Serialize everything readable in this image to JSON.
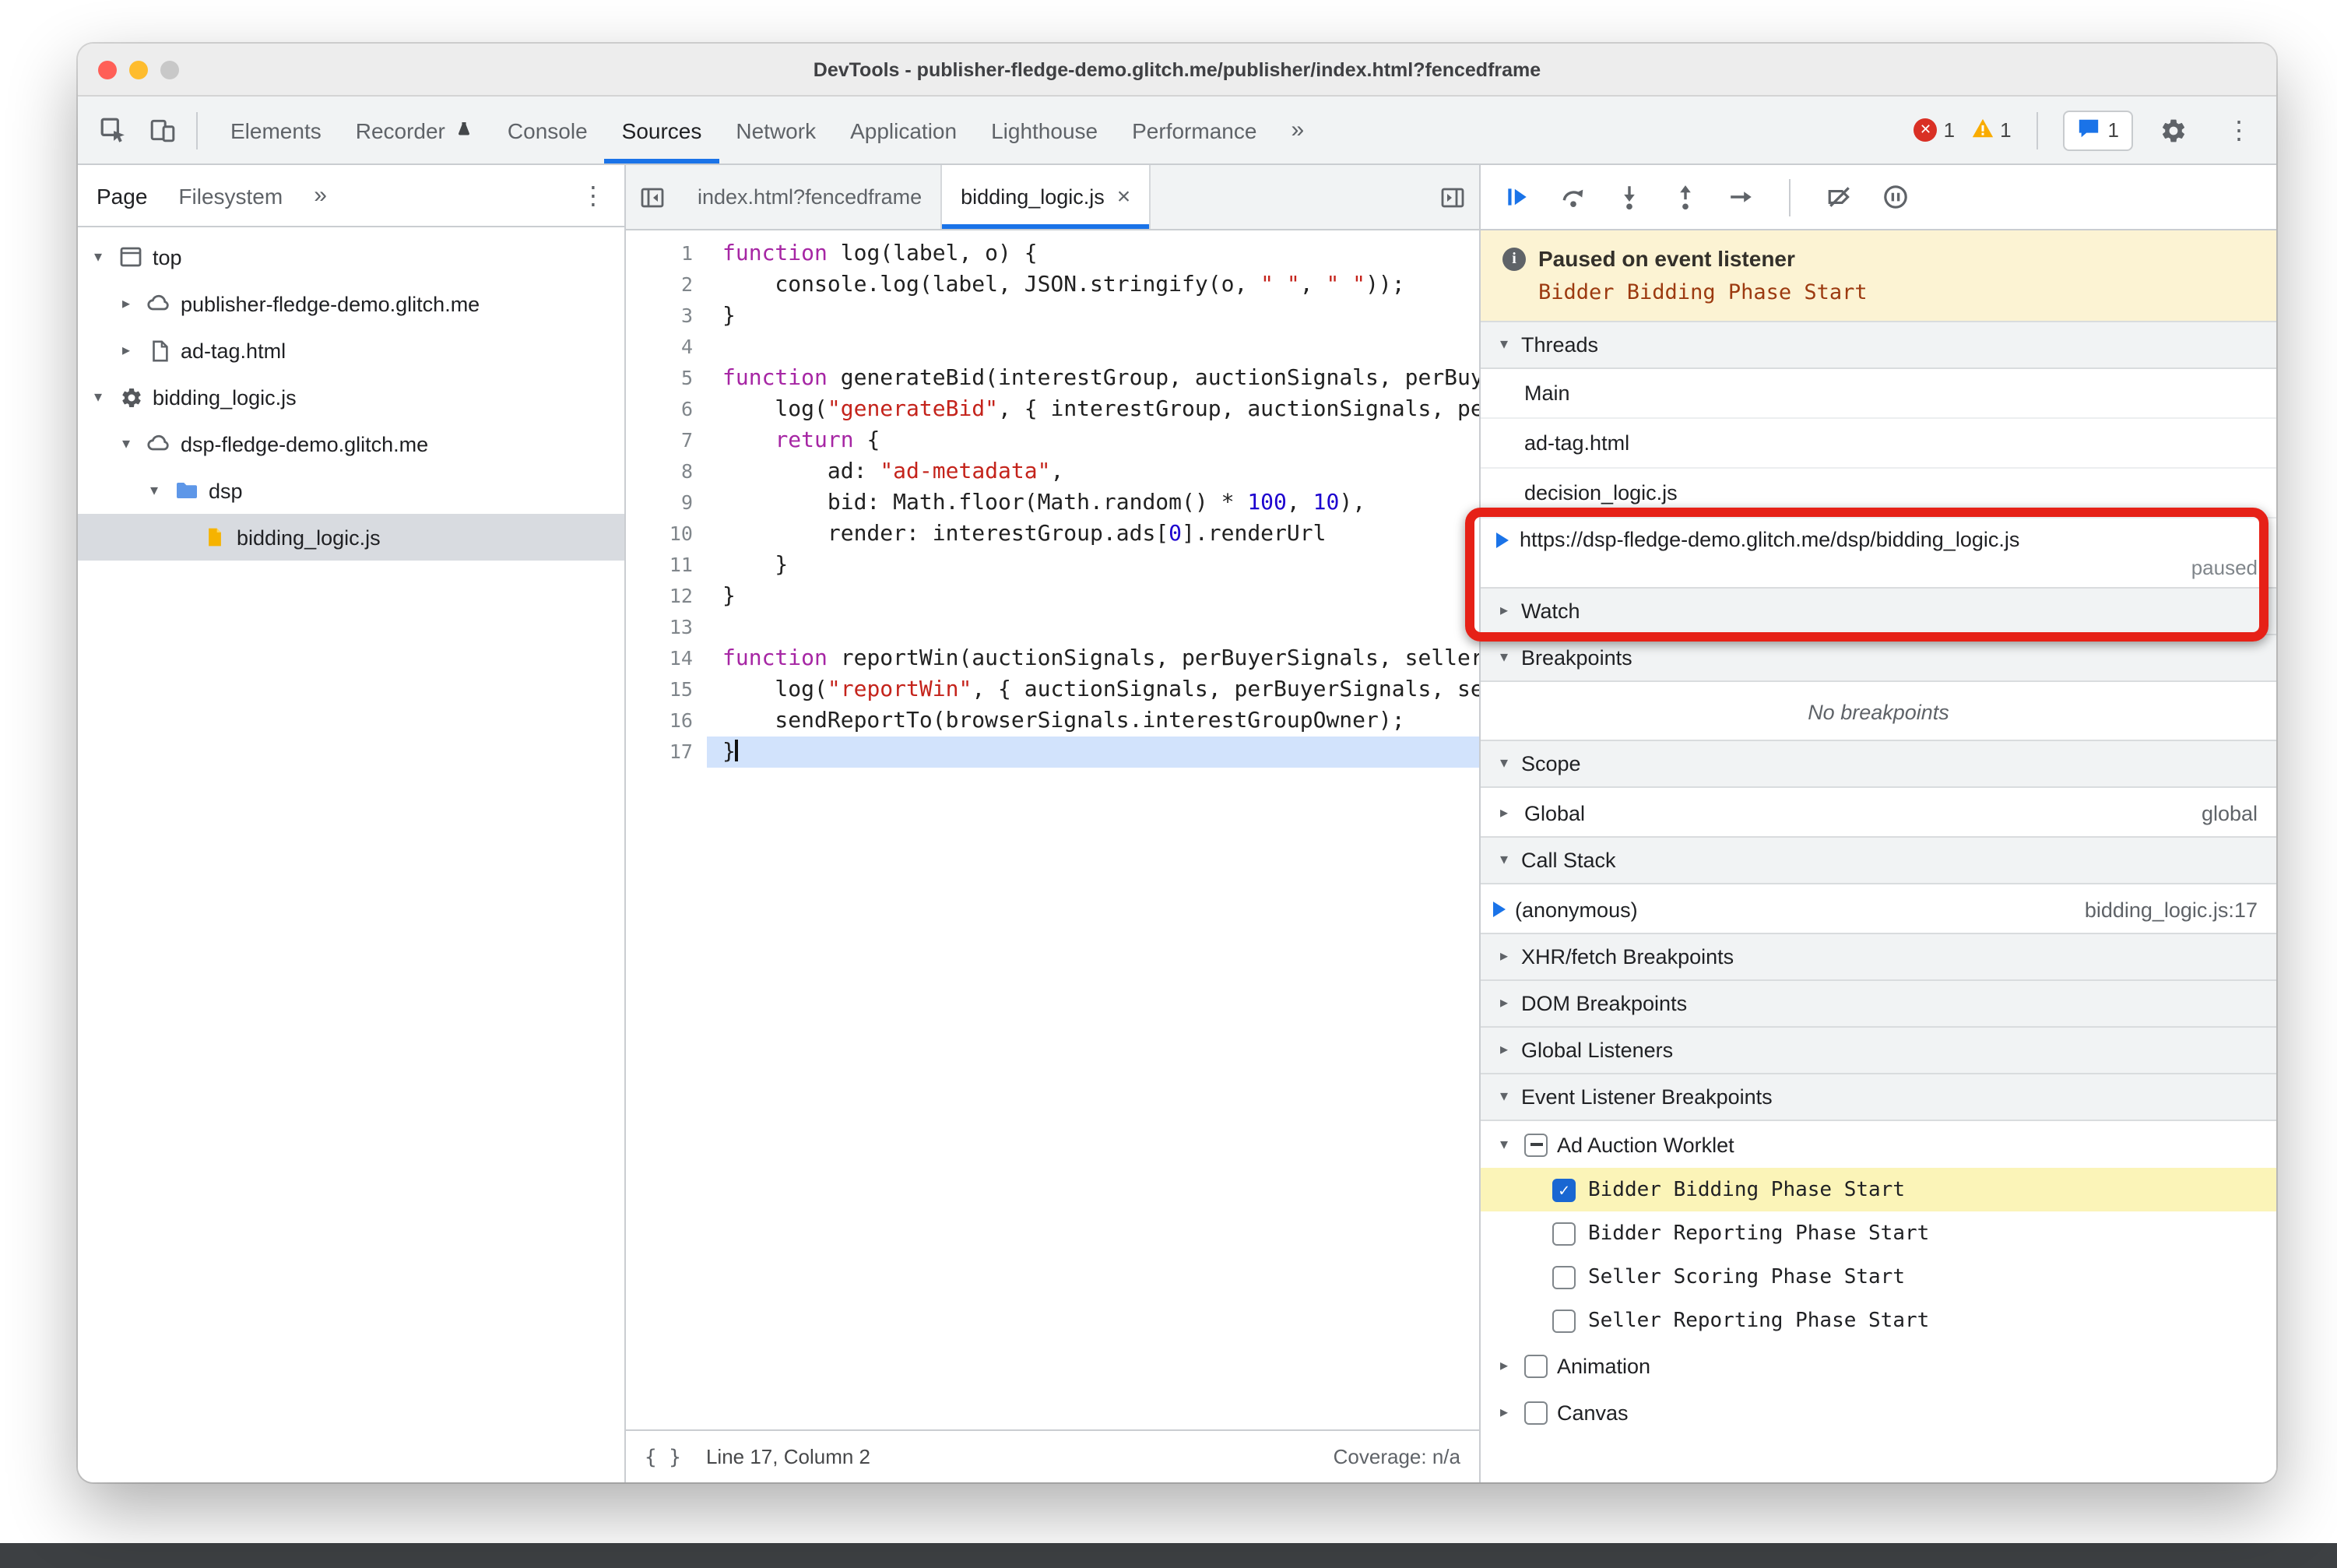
{
  "window": {
    "title": "DevTools - publisher-fledge-demo.glitch.me/publisher/index.html?fencedframe"
  },
  "toolbar": {
    "tabs": [
      "Elements",
      "Recorder",
      "Console",
      "Sources",
      "Network",
      "Application",
      "Lighthouse",
      "Performance"
    ],
    "active_tab": "Sources",
    "error_count": "1",
    "warning_count": "1",
    "issues_count": "1"
  },
  "sidebar": {
    "tabs": [
      "Page",
      "Filesystem"
    ],
    "active_tab": "Page",
    "tree": [
      {
        "label": "top",
        "icon": "frame",
        "depth": 0,
        "disclosure": "open"
      },
      {
        "label": "publisher-fledge-demo.glitch.me",
        "icon": "cloud",
        "depth": 1,
        "disclosure": "closed"
      },
      {
        "label": "ad-tag.html",
        "icon": "document",
        "depth": 1,
        "disclosure": "closed"
      },
      {
        "label": "bidding_logic.js",
        "icon": "gear",
        "depth": 0,
        "disclosure": "open"
      },
      {
        "label": "dsp-fledge-demo.glitch.me",
        "icon": "cloud",
        "depth": 1,
        "disclosure": "open"
      },
      {
        "label": "dsp",
        "icon": "folder",
        "depth": 2,
        "disclosure": "open"
      },
      {
        "label": "bidding_logic.js",
        "icon": "filejs",
        "depth": 3,
        "selected": true
      }
    ]
  },
  "editor": {
    "tabs": [
      {
        "label": "index.html?fencedframe",
        "active": false,
        "closable": false
      },
      {
        "label": "bidding_logic.js",
        "active": true,
        "closable": true
      }
    ],
    "active_line": 17,
    "lines": [
      [
        [
          "k",
          "function"
        ],
        [
          "d",
          " log(label, o) {"
        ]
      ],
      [
        [
          "d",
          "    console.log(label, JSON.stringify(o, "
        ],
        [
          "s",
          "\" \""
        ],
        [
          "d",
          ", "
        ],
        [
          "s",
          "\" \""
        ],
        [
          "d",
          "));"
        ]
      ],
      [
        [
          "d",
          "}"
        ]
      ],
      [],
      [
        [
          "k",
          "function"
        ],
        [
          "d",
          " generateBid(interestGroup, auctionSignals, perBuyerSignals, trustedBiddingSignals, browserSignals) {"
        ]
      ],
      [
        [
          "d",
          "    log("
        ],
        [
          "s",
          "\"generateBid\""
        ],
        [
          "d",
          ", { interestGroup, auctionSignals, perBuyerSignals, trustedBiddingSignals, browserSignals });"
        ]
      ],
      [
        [
          "d",
          "    "
        ],
        [
          "k",
          "return"
        ],
        [
          "d",
          " {"
        ]
      ],
      [
        [
          "d",
          "        ad: "
        ],
        [
          "s",
          "\"ad-metadata\""
        ],
        [
          "d",
          ","
        ]
      ],
      [
        [
          "d",
          "        bid: Math.floor(Math.random() * "
        ],
        [
          "n",
          "100"
        ],
        [
          "d",
          ", "
        ],
        [
          "n",
          "10"
        ],
        [
          "d",
          "),"
        ]
      ],
      [
        [
          "d",
          "        render: interestGroup.ads["
        ],
        [
          "n",
          "0"
        ],
        [
          "d",
          "].renderUrl"
        ]
      ],
      [
        [
          "d",
          "    }"
        ]
      ],
      [
        [
          "d",
          "}"
        ]
      ],
      [],
      [
        [
          "k",
          "function"
        ],
        [
          "d",
          " reportWin(auctionSignals, perBuyerSignals, sellerSignals, browserSignals) {"
        ]
      ],
      [
        [
          "d",
          "    log("
        ],
        [
          "s",
          "\"reportWin\""
        ],
        [
          "d",
          ", { auctionSignals, perBuyerSignals, sellerSignals, browserSignals });"
        ]
      ],
      [
        [
          "d",
          "    sendReportTo(browserSignals.interestGroupOwner);"
        ]
      ],
      [
        [
          "d",
          "}"
        ]
      ]
    ],
    "status": {
      "position": "Line 17, Column 2",
      "coverage": "Coverage: n/a"
    }
  },
  "debugger": {
    "banner": {
      "title": "Paused on event listener",
      "detail": "Bidder Bidding Phase Start"
    },
    "threads": {
      "title": "Threads",
      "items": [
        {
          "label": "Main"
        },
        {
          "label": "ad-tag.html"
        },
        {
          "label": "decision_logic.js"
        },
        {
          "label": "https://dsp-fledge-demo.glitch.me/dsp/bidding_logic.js",
          "status": "paused",
          "current": true
        }
      ]
    },
    "watch": {
      "title": "Watch"
    },
    "breakpoints": {
      "title": "Breakpoints",
      "empty": "No breakpoints"
    },
    "scope": {
      "title": "Scope",
      "rows": [
        {
          "label": "Global",
          "value": "global"
        }
      ]
    },
    "call_stack": {
      "title": "Call Stack",
      "frames": [
        {
          "label": "(anonymous)",
          "location": "bidding_logic.js:17",
          "current": true
        }
      ]
    },
    "xhr_breakpoints": {
      "title": "XHR/fetch Breakpoints"
    },
    "dom_breakpoints": {
      "title": "DOM Breakpoints"
    },
    "global_listeners": {
      "title": "Global Listeners"
    },
    "event_listener_breakpoints": {
      "title": "Event Listener Breakpoints",
      "groups": [
        {
          "label": "Ad Auction Worklet",
          "state": "indeterminate",
          "expanded": true,
          "children": [
            {
              "label": "Bidder Bidding Phase Start",
              "checked": true,
              "highlighted": true
            },
            {
              "label": "Bidder Reporting Phase Start",
              "checked": false
            },
            {
              "label": "Seller Scoring Phase Start",
              "checked": false
            },
            {
              "label": "Seller Reporting Phase Start",
              "checked": false
            }
          ]
        },
        {
          "label": "Animation",
          "state": "unchecked",
          "expanded": false,
          "children": []
        },
        {
          "label": "Canvas",
          "state": "unchecked",
          "expanded": false,
          "children": []
        }
      ]
    }
  },
  "colors": {
    "accent": "#1a73e8",
    "annotation_red": "#e62117",
    "paused_banner_bg": "#fcf3d3",
    "exec_line_bg": "#d2e3fc"
  }
}
